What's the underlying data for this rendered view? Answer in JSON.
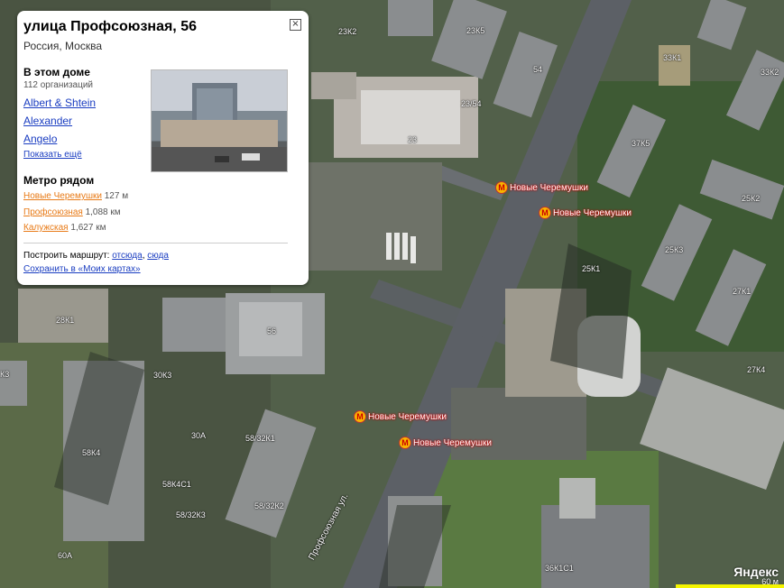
{
  "balloon": {
    "title": "улица Профсоюзная, 56",
    "subtitle": "Россия, Москва",
    "close_label": "×",
    "house_heading": "В этом доме",
    "org_count": "112 организаций",
    "orgs": [
      "Albert & Shtein",
      "Alexander",
      "Angelo"
    ],
    "show_more": "Показать ещё",
    "metro_heading": "Метро рядом",
    "metro": [
      {
        "name": "Новые Черемушки",
        "dist": "127 м"
      },
      {
        "name": "Профсоюзная",
        "dist": "1,088 км"
      },
      {
        "name": "Калужская",
        "dist": "1,627 км"
      }
    ],
    "route_label": "Построить маршрут:",
    "route_from": "отсюда",
    "route_to": "сюда",
    "save_label": "Сохранить в «Моих картах»"
  },
  "map": {
    "metro_label": "Новые Черемушки",
    "metro_icon": "М",
    "street": "Профсоюзная ул.",
    "buildings": [
      "23К2",
      "23К5",
      "33К1",
      "33К2",
      "54",
      "23/54",
      "23",
      "37К5",
      "25К2",
      "25К3",
      "25К1",
      "27К1",
      "27К4",
      "28К1",
      "56",
      "30К3",
      "30А",
      "58К4",
      "58/32К1",
      "58К4С1",
      "58/32К2",
      "58/32К3",
      "60А",
      "36К1С1",
      "К3"
    ],
    "brand": "Яндекс",
    "scale": "60 м"
  },
  "colors": {
    "metro_accent": "#cc0000",
    "link": "#1a3dc1",
    "metro_link": "#e87a16"
  }
}
